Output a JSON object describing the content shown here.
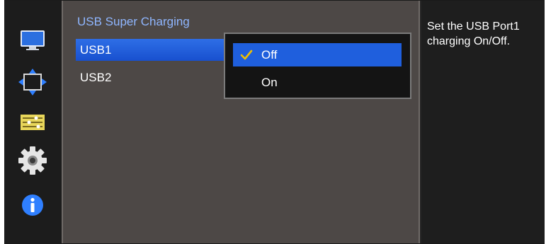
{
  "menu": {
    "title": "USB Super Charging",
    "items": [
      {
        "label": "USB1",
        "selected": true
      },
      {
        "label": "USB2",
        "selected": false
      }
    ]
  },
  "dropdown": {
    "options": [
      {
        "label": "Off",
        "selected": true
      },
      {
        "label": "On",
        "selected": false
      }
    ]
  },
  "help": {
    "text": "Set the USB Port1 charging On/Off."
  },
  "rail": {
    "icons": [
      "monitor-icon",
      "resize-arrows-icon",
      "sliders-icon",
      "gear-icon",
      "info-icon"
    ]
  },
  "colors": {
    "accent_blue": "#1f5fdd",
    "title_blue": "#8fb6ff",
    "check_yellow": "#f0c000"
  }
}
